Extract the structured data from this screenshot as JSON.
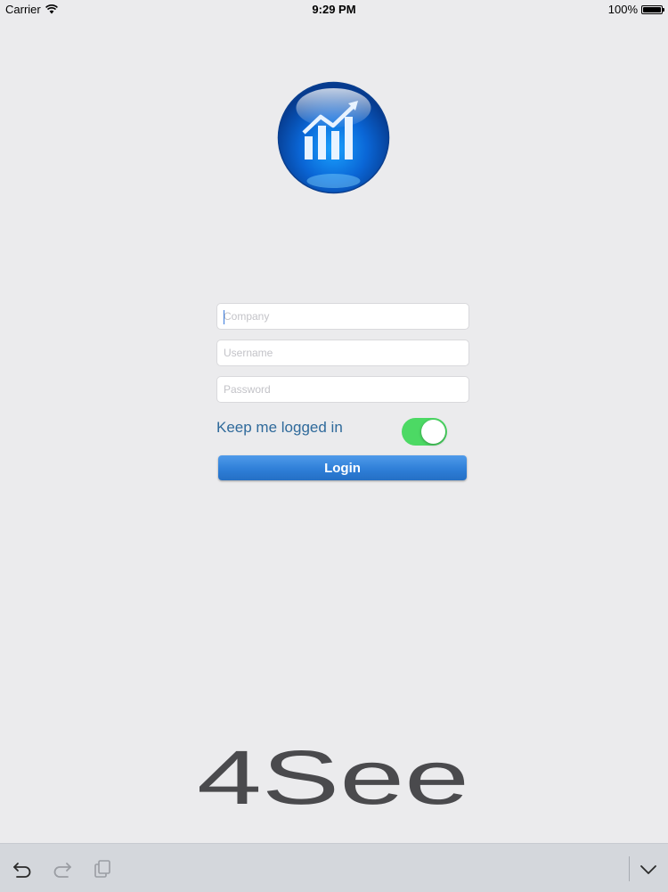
{
  "status_bar": {
    "carrier": "Carrier",
    "time": "9:29 PM",
    "battery": "100%",
    "battery_level": 1.0
  },
  "login_form": {
    "company_placeholder": "Company",
    "username_placeholder": "Username",
    "password_placeholder": "Password",
    "keep_logged_in_label": "Keep me logged in",
    "keep_logged_in": true,
    "login_label": "Login"
  },
  "brand": {
    "name": "4See"
  },
  "toolbar": {
    "icons": [
      "undo-icon",
      "redo-icon",
      "paste-icon",
      "chevron-down-icon"
    ]
  },
  "colors": {
    "background": "#ebebed",
    "toggle_on": "#4cd964",
    "login_button": "#2f7fd8",
    "label_text": "#2f6a9b"
  }
}
